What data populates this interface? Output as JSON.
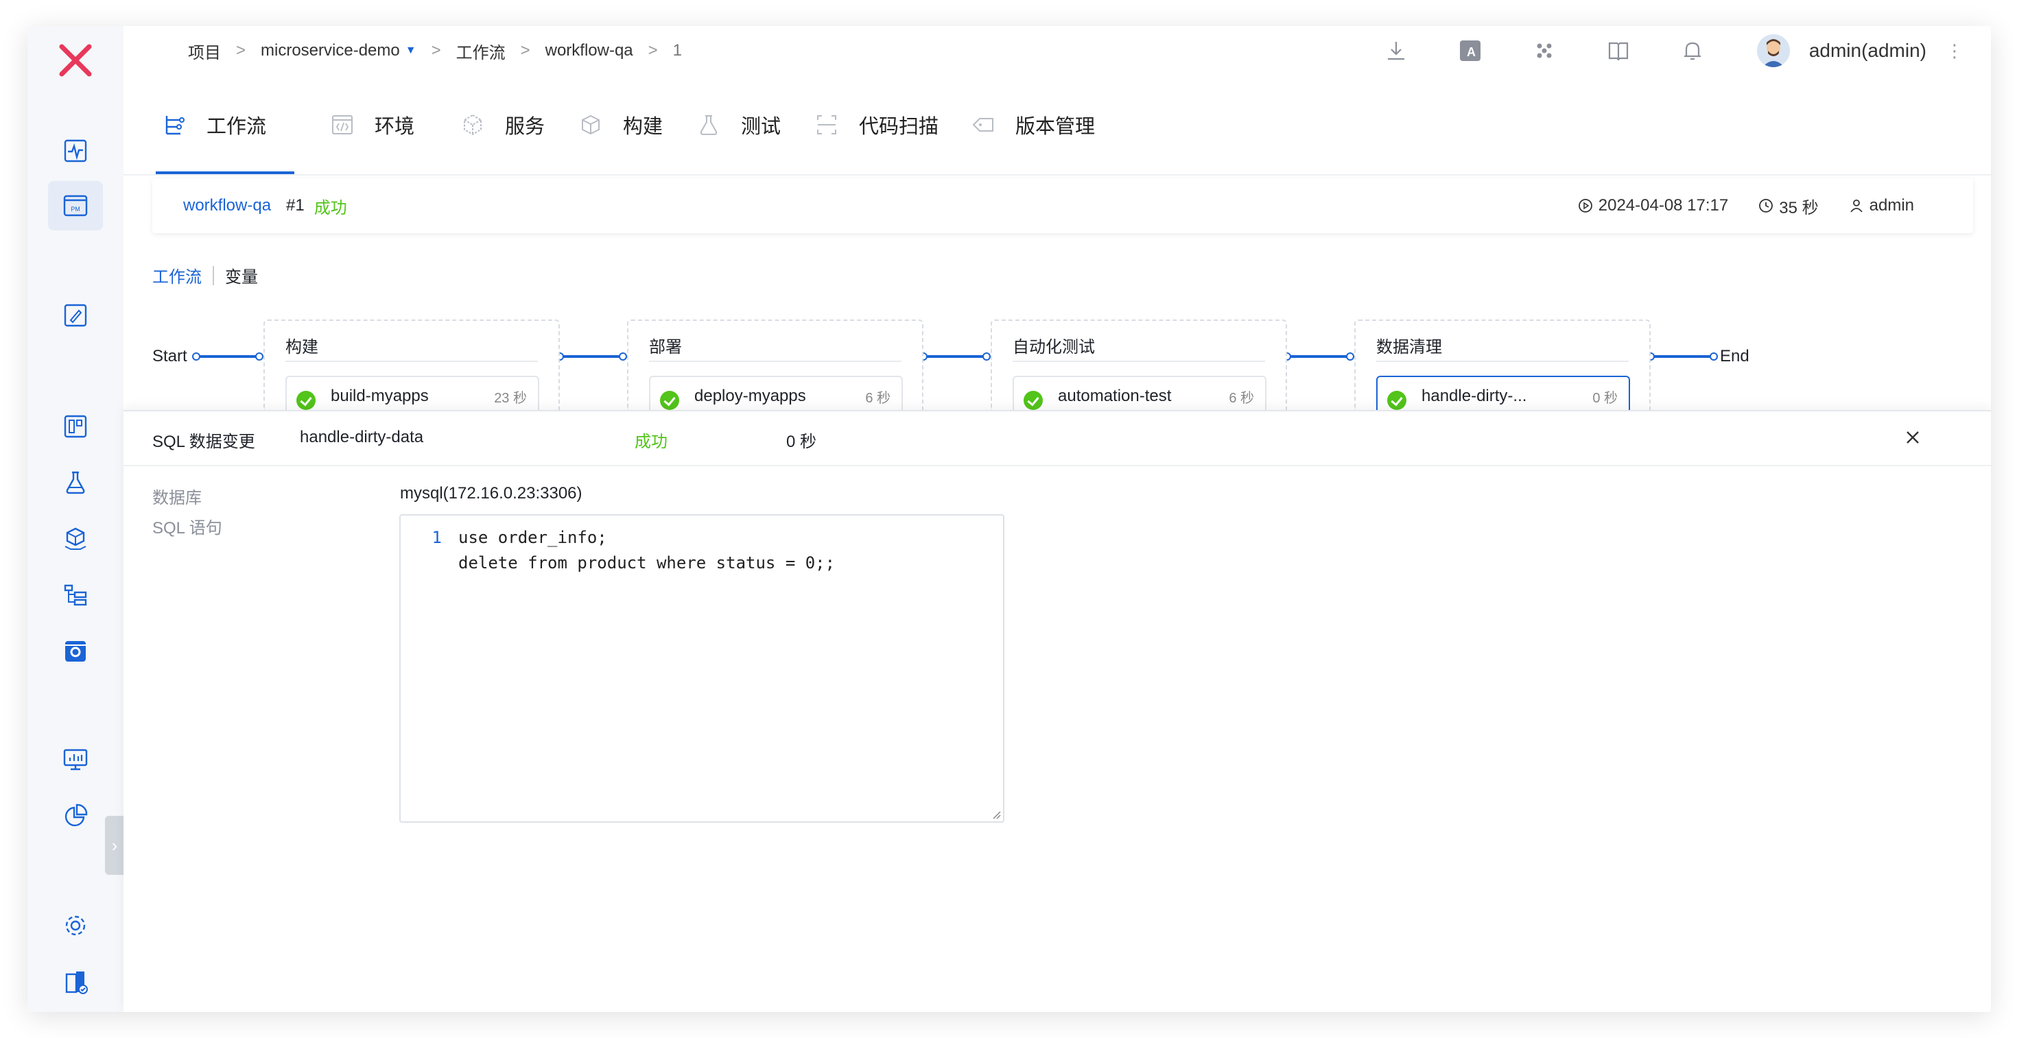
{
  "breadcrumb": {
    "items": [
      "项目",
      "microservice-demo",
      "工作流",
      "workflow-qa",
      "1"
    ],
    "separator": ">"
  },
  "user": {
    "name": "admin(admin)"
  },
  "tabs": [
    {
      "label": "工作流",
      "icon": "workflow-icon"
    },
    {
      "label": "环境",
      "icon": "code-env-icon"
    },
    {
      "label": "服务",
      "icon": "service-cube-icon"
    },
    {
      "label": "构建",
      "icon": "build-box-icon"
    },
    {
      "label": "测试",
      "icon": "flask-icon"
    },
    {
      "label": "代码扫描",
      "icon": "scan-icon"
    },
    {
      "label": "版本管理",
      "icon": "version-tag-icon"
    }
  ],
  "run": {
    "workflow": "workflow-qa",
    "number": "#1",
    "status": "成功",
    "started_at": "2024-04-08 17:17",
    "duration": "35 秒",
    "creator": "admin"
  },
  "subtabs": [
    "工作流",
    "变量"
  ],
  "pipeline": {
    "start": "Start",
    "end": "End",
    "stages": [
      {
        "title": "构建",
        "job": "build-myapps",
        "time": "23 秒"
      },
      {
        "title": "部署",
        "job": "deploy-myapps",
        "time": "6 秒"
      },
      {
        "title": "自动化测试",
        "job": "automation-test",
        "time": "6 秒"
      },
      {
        "title": "数据清理",
        "job": "handle-dirty-...",
        "time": "0 秒"
      }
    ]
  },
  "drawer": {
    "type": "SQL 数据变更",
    "job": "handle-dirty-data",
    "status": "成功",
    "duration": "0 秒",
    "db_label": "数据库",
    "db_value": "mysql(172.16.0.23:3306)",
    "sql_label": "SQL 语句",
    "sql_lines": [
      {
        "no": "1",
        "text": "use order_info;"
      },
      {
        "no": "",
        "text": "delete from product where status = 0;;"
      }
    ]
  },
  "colors": {
    "accent": "#1a64d6",
    "success": "#52c41a",
    "brand_logo": "#e8385b"
  }
}
